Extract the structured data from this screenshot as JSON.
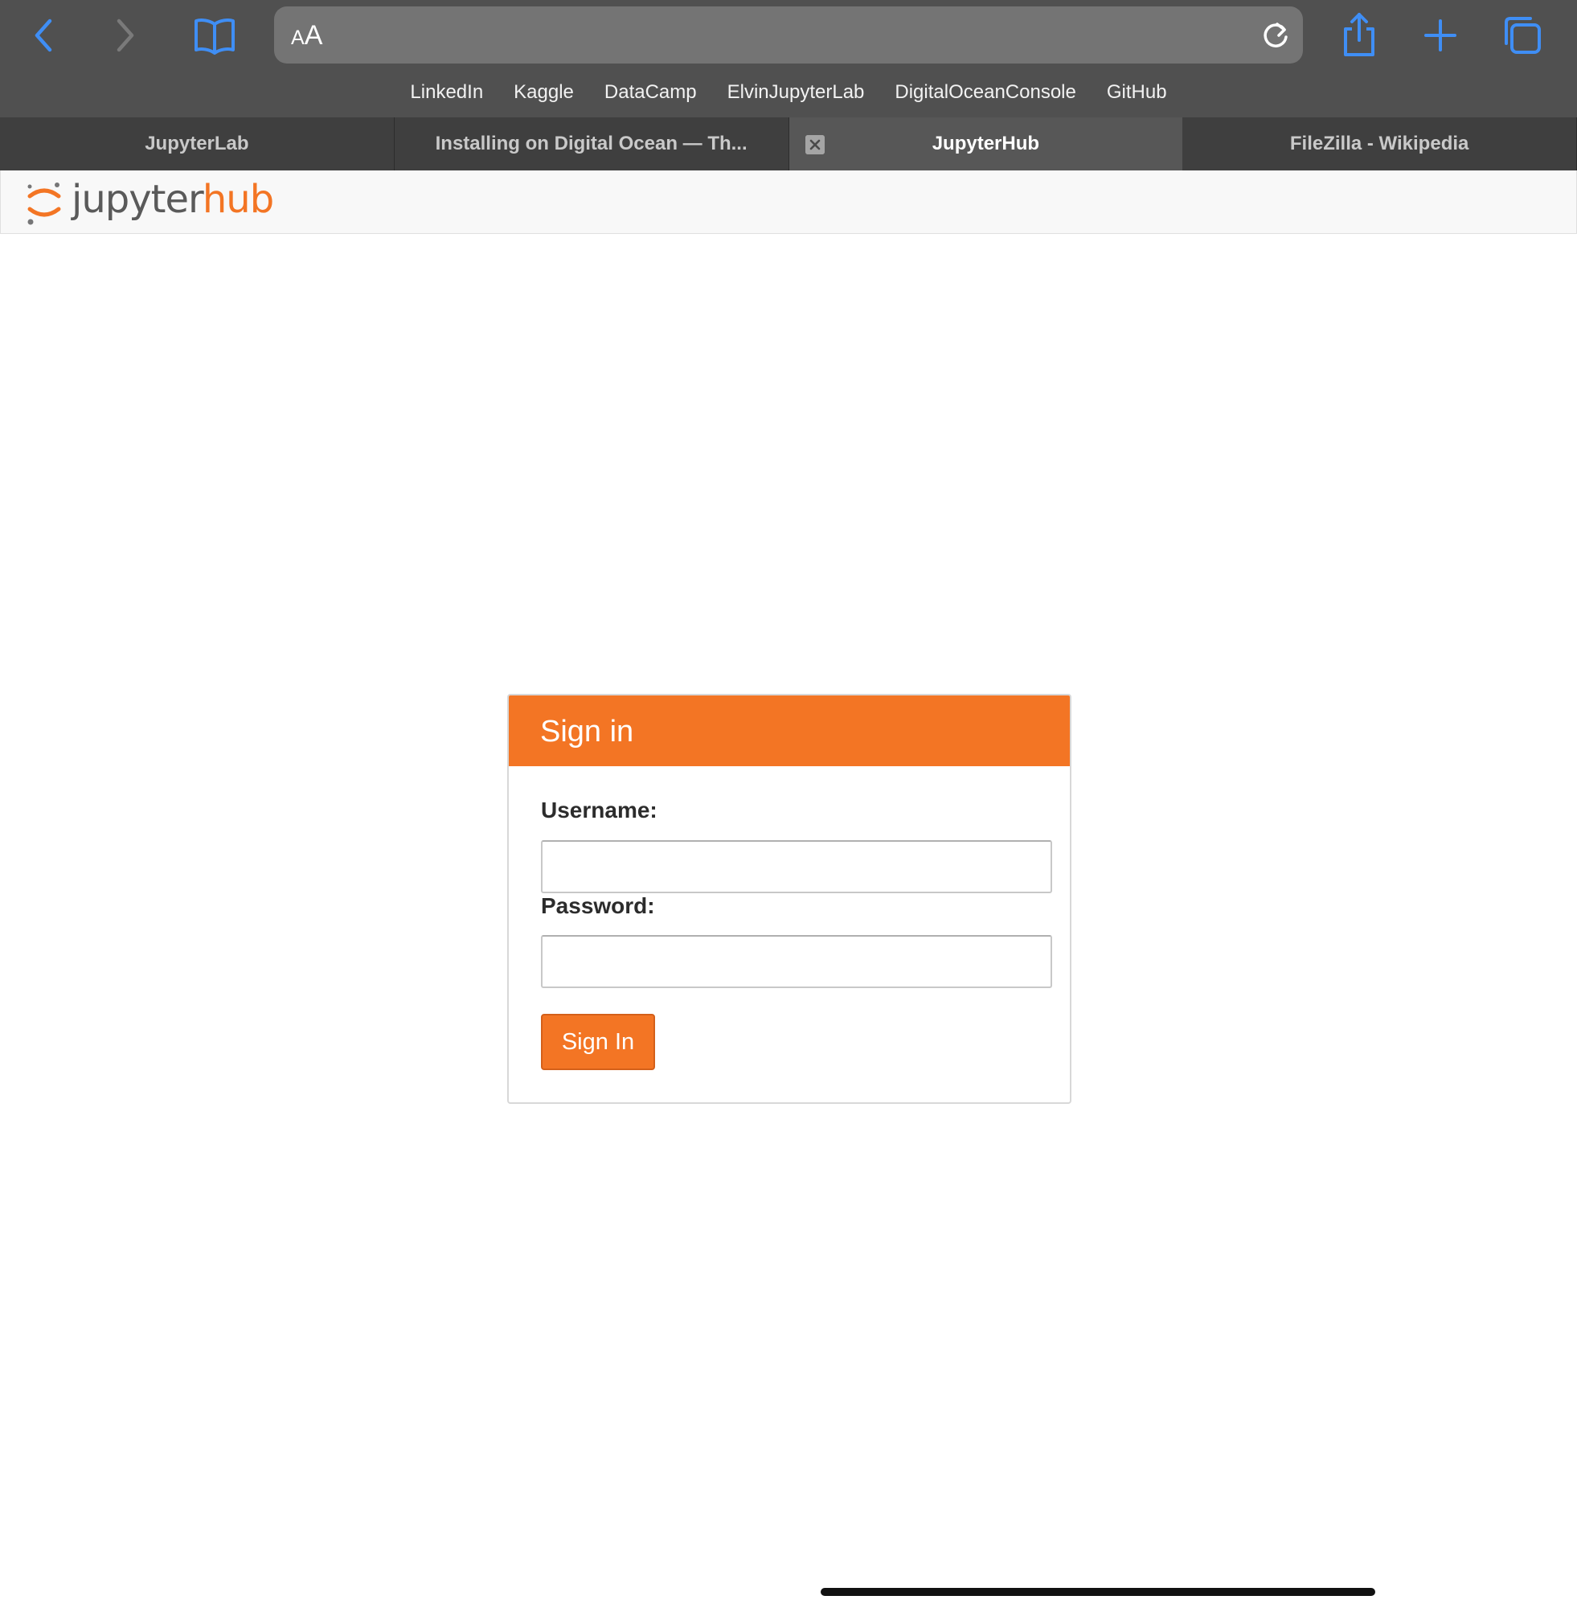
{
  "browser": {
    "address_bar": {
      "reader_label_small": "A",
      "reader_label_large": "A",
      "url": ""
    },
    "bookmarks": [
      "LinkedIn",
      "Kaggle",
      "DataCamp",
      "ElvinJupyterLab",
      "DigitalOceanConsole",
      "GitHub"
    ],
    "tabs": [
      {
        "title": "JupyterLab",
        "active": false
      },
      {
        "title": "Installing on Digital Ocean — Th...",
        "active": false
      },
      {
        "title": "JupyterHub",
        "active": true
      },
      {
        "title": "FileZilla - Wikipedia",
        "active": false
      }
    ],
    "accent_color": "#3b82f6"
  },
  "page": {
    "logo": {
      "part1": "jupyter",
      "part2": "hub"
    },
    "login": {
      "title": "Sign in",
      "username_label": "Username:",
      "username_value": "",
      "password_label": "Password:",
      "password_value": "",
      "submit_label": "Sign In"
    },
    "brand_color": "#f37524"
  }
}
